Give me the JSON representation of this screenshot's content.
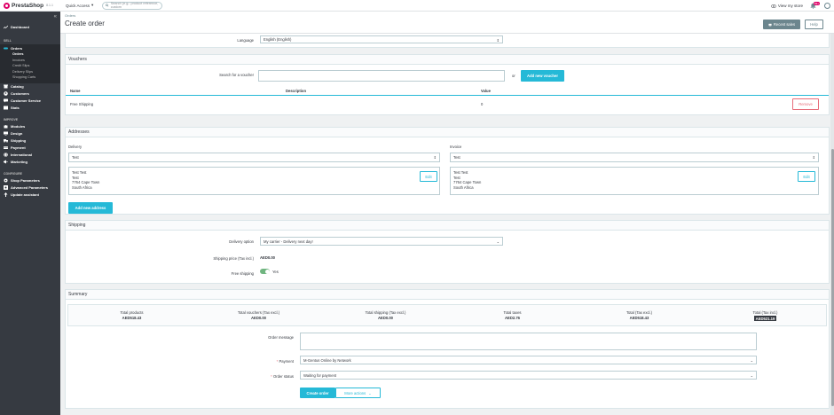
{
  "topbar": {
    "logo_text": "PrestaShop",
    "version": "8.1.1",
    "quick_access": "Quick Access",
    "search_placeholder": "Search (e.g.: product reference, custom",
    "view_store": "View my store",
    "notification_count": "99+"
  },
  "sidebar": {
    "dashboard": "Dashboard",
    "sell_section": "SELL",
    "orders": "Orders",
    "orders_sub": [
      "Orders",
      "Invoices",
      "Credit Slips",
      "Delivery Slips",
      "Shopping Carts"
    ],
    "catalog": "Catalog",
    "customers": "Customers",
    "customer_service": "Customer Service",
    "stats": "Stats",
    "improve_section": "IMPROVE",
    "modules": "Modules",
    "design": "Design",
    "shipping": "Shipping",
    "payment": "Payment",
    "international": "International",
    "marketing": "Marketing",
    "configure_section": "CONFIGURE",
    "shop_parameters": "Shop Parameters",
    "advanced_parameters": "Advanced Parameters",
    "update_assistant": "Update assistant"
  },
  "header": {
    "breadcrumb": "Orders",
    "title": "Create order",
    "recent_sales": "Recent sales",
    "help": "Help"
  },
  "language": {
    "label": "Language",
    "value": "English (English)"
  },
  "vouchers": {
    "title": "Vouchers",
    "search_label": "Search for a voucher",
    "or": "or",
    "add_button": "Add new voucher",
    "columns": [
      "Name",
      "Description",
      "Value"
    ],
    "rows": [
      {
        "name": "Free Shipping",
        "description": "",
        "value": "0",
        "action": "Remove"
      }
    ]
  },
  "addresses": {
    "title": "Addresses",
    "delivery_label": "Delivery",
    "invoice_label": "Invoice",
    "delivery_select": "Test",
    "invoice_select": "Test",
    "delivery_lines": [
      "Test Test",
      "Test",
      "7764 Cape Town",
      "South Africa"
    ],
    "invoice_lines": [
      "Test Test",
      "Test",
      "7764 Cape Town",
      "South Africa"
    ],
    "edit": "Edit",
    "add_button": "Add new address"
  },
  "shipping": {
    "title": "Shipping",
    "delivery_option_label": "Delivery option",
    "delivery_option_value": "My carrier - Delivery next day!",
    "shipping_price_label": "Shipping price (Tax incl.)",
    "shipping_price_value": "AED0.00",
    "free_shipping_label": "Free shipping",
    "free_shipping_value": "Yes"
  },
  "summary": {
    "title": "Summary",
    "totals": [
      {
        "label": "Total products",
        "value": "AED518.43"
      },
      {
        "label": "Total vouchers (Tax excl.)",
        "value": "AED0.00"
      },
      {
        "label": "Total shipping (Tax excl.)",
        "value": "AED0.00"
      },
      {
        "label": "Total taxes",
        "value": "AED2.76"
      },
      {
        "label": "Total (Tax excl.)",
        "value": "AED518.43"
      },
      {
        "label": "Total (Tax incl.)",
        "value": "AED521.19"
      }
    ],
    "order_message_label": "Order message",
    "payment_label": "Payment",
    "payment_value": "M-Gentus Online by Network",
    "order_status_label": "Order status",
    "order_status_value": "Waiting for payment",
    "create_button": "Create order",
    "more_actions": "More actions"
  },
  "colors": {
    "primary": "#25b9d7",
    "sidebar": "#363a41",
    "danger": "#e76d7a",
    "success": "#70b580"
  }
}
